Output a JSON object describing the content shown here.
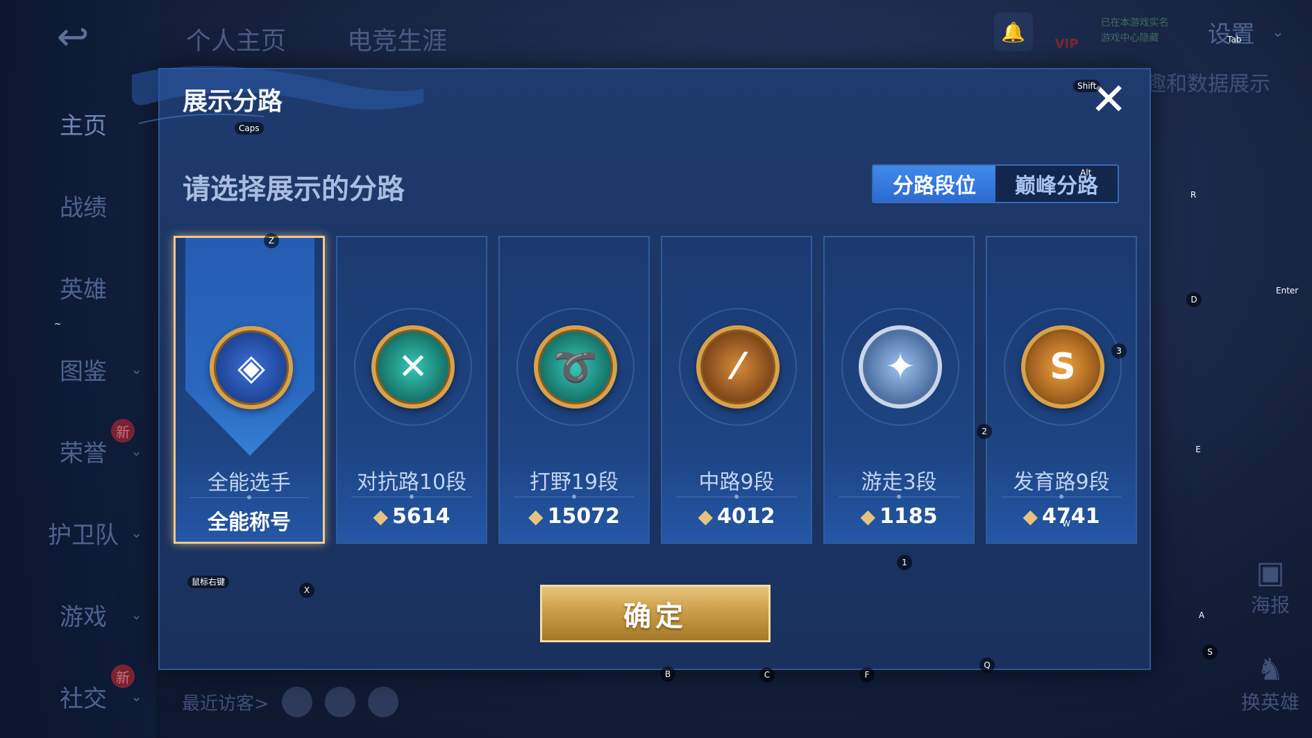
{
  "top_tabs": [
    "个人主页",
    "电竞生涯"
  ],
  "left_nav": [
    {
      "label": "主页",
      "active": true,
      "chevron": false,
      "badge": ""
    },
    {
      "label": "战绩",
      "active": false,
      "chevron": false,
      "badge": ""
    },
    {
      "label": "英雄",
      "active": false,
      "chevron": false,
      "badge": ""
    },
    {
      "label": "图鉴",
      "active": false,
      "chevron": true,
      "badge": ""
    },
    {
      "label": "荣誉",
      "active": false,
      "chevron": true,
      "badge": "新"
    },
    {
      "label": "护卫队",
      "active": false,
      "chevron": true,
      "badge": ""
    },
    {
      "label": "游戏",
      "active": false,
      "chevron": true,
      "badge": ""
    },
    {
      "label": "社交",
      "active": false,
      "chevron": true,
      "badge": "新"
    }
  ],
  "top_right": {
    "settings": "设置",
    "vip": "VIP",
    "status_line1": "已在本游戏实名",
    "status_line2": "游戏中心隐藏"
  },
  "background": {
    "right_text": "趣和数据展示",
    "recent_visitors": "最近访客>",
    "poster": "海报",
    "swap_hero": "换英雄"
  },
  "dialog": {
    "title": "展示分路",
    "subtitle": "请选择展示的分路",
    "segments": [
      {
        "label": "分路段位",
        "active": true
      },
      {
        "label": "巅峰分路",
        "active": false
      }
    ],
    "cards": [
      {
        "label": "全能选手",
        "value": "全能称号",
        "emblem_icon": "all-round-emblem-icon",
        "style": "blue",
        "selected": true,
        "has_points": false
      },
      {
        "label": "对抗路10段",
        "value": "5614",
        "emblem_icon": "clash-lane-emblem-icon",
        "style": "teal",
        "selected": false,
        "has_points": true
      },
      {
        "label": "打野19段",
        "value": "15072",
        "emblem_icon": "jungle-dragon-emblem-icon",
        "style": "teal",
        "selected": false,
        "has_points": true
      },
      {
        "label": "中路9段",
        "value": "4012",
        "emblem_icon": "mid-lane-emblem-icon",
        "style": "gold",
        "selected": false,
        "has_points": true
      },
      {
        "label": "游走3段",
        "value": "1185",
        "emblem_icon": "roam-wings-emblem-icon",
        "style": "silver",
        "selected": false,
        "has_points": true
      },
      {
        "label": "发育路9段",
        "value": "4741",
        "emblem_icon": "farm-lane-emblem-icon",
        "style": "orange",
        "selected": false,
        "has_points": true
      }
    ],
    "confirm": "确定"
  },
  "key_hints": {
    "caps": "Caps",
    "shift": "Shift",
    "tab": "Tab",
    "alt": "Alt",
    "enter": "Enter",
    "mouse_right": "鼠标右键",
    "tilde": "~",
    "z": "Z",
    "x": "X",
    "r": "R",
    "d": "D",
    "e": "E",
    "a": "A",
    "s": "S",
    "b": "B",
    "c": "C",
    "f": "F",
    "q": "Q",
    "w": "W",
    "n1": "1",
    "n2": "2",
    "n3": "3"
  },
  "colors": {
    "dialog_bg": "#1f3b6e",
    "accent_blue": "#3f8aea",
    "selected_border": "#f0c98a",
    "confirm_gold": "#c99a44"
  }
}
